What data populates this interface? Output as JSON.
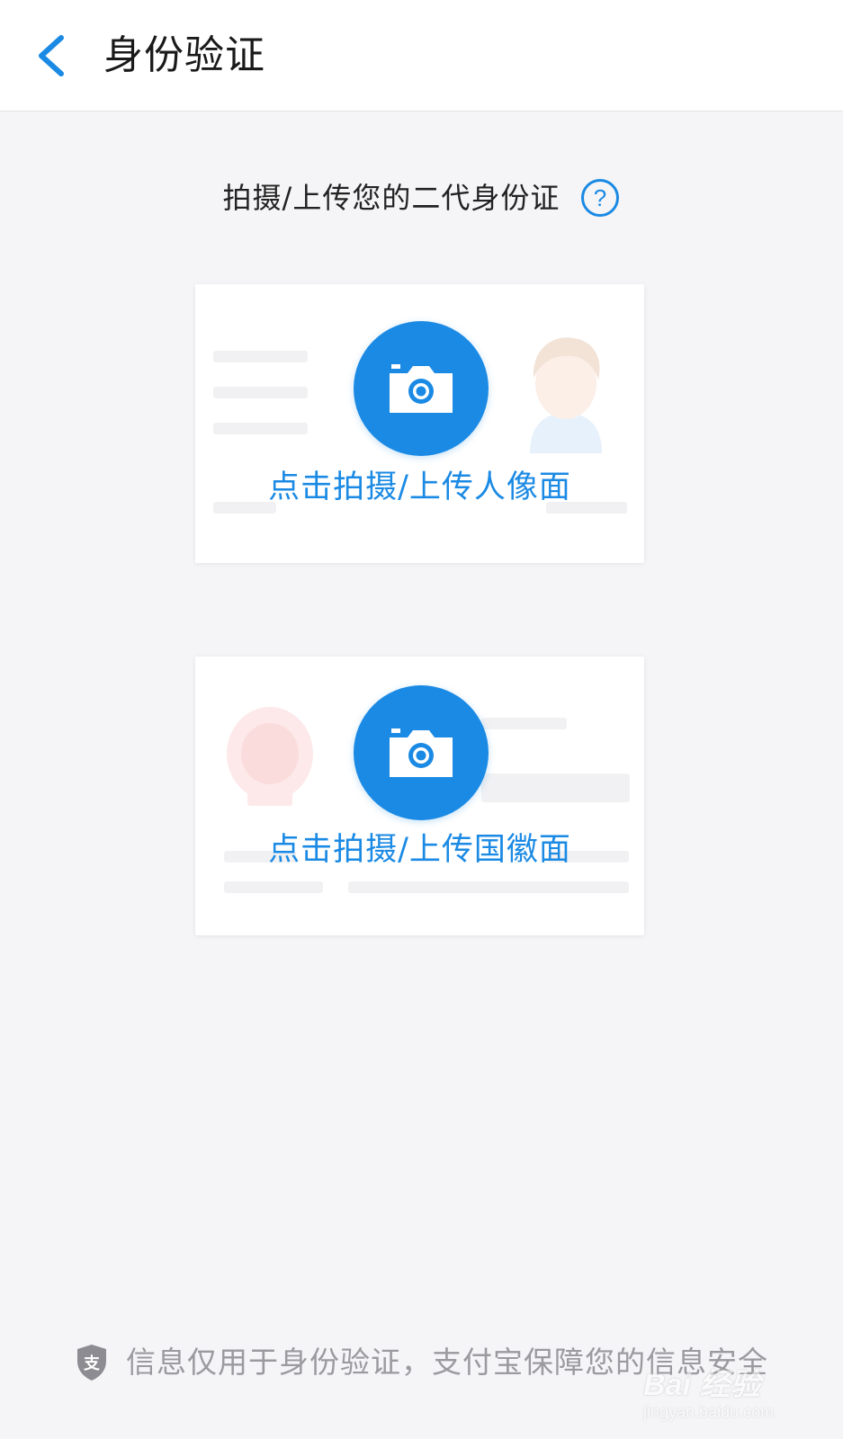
{
  "header": {
    "title": "身份验证",
    "back_icon": "chevron-left-icon"
  },
  "instruction": {
    "text": "拍摄/上传您的二代身份证",
    "help_icon": "question-circle-icon",
    "help_label": "?"
  },
  "cards": [
    {
      "label": "点击拍摄/上传人像面",
      "icon": "camera-icon",
      "side": "portrait"
    },
    {
      "label": "点击拍摄/上传国徽面",
      "icon": "camera-icon",
      "side": "national-emblem"
    }
  ],
  "footer": {
    "text": "信息仅用于身份验证，支付宝保障您的信息安全",
    "icon": "alipay-shield-icon",
    "icon_glyph": "支"
  },
  "watermark": {
    "brand": "Bai 经验",
    "url": "jingyan.baidu.com"
  },
  "colors": {
    "accent": "#1b8ae4",
    "background": "#f5f5f7",
    "header_bg": "#ffffff",
    "muted_text": "#9a9a9f"
  }
}
